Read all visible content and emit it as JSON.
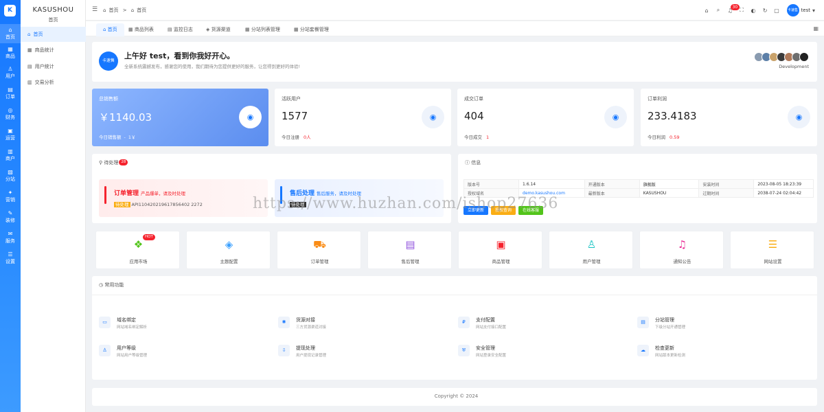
{
  "rail": {
    "logo": "K",
    "items": [
      "首页",
      "商品",
      "用户",
      "订单",
      "财务",
      "运营",
      "商户",
      "分站",
      "营销",
      "装修",
      "服务",
      "设置"
    ]
  },
  "side": {
    "brand": "KASUSHOU",
    "sub": "首页",
    "items": [
      "首页",
      "商品统计",
      "用户统计",
      "交易分析"
    ]
  },
  "header": {
    "crumb": [
      "首页",
      ">",
      "首页"
    ],
    "notif_count": "30",
    "avatar_text": "卡速售",
    "username": "test"
  },
  "tabs": [
    "首页",
    "商品列表",
    "监控日志",
    "货源渠道",
    "分站列表管理",
    "分站套餐管理"
  ],
  "welcome": {
    "logo_text": "卡速售",
    "title": "上午好 test，看到你我好开心。",
    "subtitle": "全新系统震撼发布，感谢您的使用，我们期待为您提供更好的服务，让您得到更好的体验!",
    "team_label": "Development"
  },
  "stats": [
    {
      "title": "总销售额",
      "value": "￥1140.03",
      "foot": "今日销售额",
      "foot_value": "1￥"
    },
    {
      "title": "活跃用户",
      "value": "1577",
      "foot": "今日注册",
      "foot_value": "0人"
    },
    {
      "title": "成交订单",
      "value": "404",
      "foot": "今日成交",
      "foot_value": "1"
    },
    {
      "title": "订单利润",
      "value": "233.4183",
      "foot": "今日利润",
      "foot_value": "0.59"
    }
  ],
  "pending": {
    "title": "待处理",
    "count": "28",
    "order": {
      "title": "订单管理",
      "desc": "产品爆单，请及时处理",
      "tag": "待处理",
      "order_no": "API110420219617856402 2272"
    },
    "after": {
      "title": "售后处理",
      "desc": "售后服务，请及时处理",
      "tag": "待处理"
    }
  },
  "info": {
    "title": "信息",
    "rows": [
      [
        "版本号",
        "1.6.14",
        "开通版本",
        "旗舰版",
        "安装时间",
        "2023-08-05 18:23:39"
      ],
      [
        "授权域名",
        "demo.kasushou.com",
        "最新版本",
        "KASUSHOU",
        "过期时间",
        "2038-07-24 02:04:42"
      ]
    ],
    "buttons": [
      "立即更新",
      "授权查询",
      "在线客服"
    ]
  },
  "quick": [
    {
      "label": "应用市场",
      "icon": "app-grid-icon",
      "hot": "HOT"
    },
    {
      "label": "主题配置",
      "icon": "theme-icon"
    },
    {
      "label": "订单管理",
      "icon": "cart-icon"
    },
    {
      "label": "售后管理",
      "icon": "document-icon"
    },
    {
      "label": "商品管理",
      "icon": "box-icon"
    },
    {
      "label": "用户管理",
      "icon": "user-icon"
    },
    {
      "label": "通知公告",
      "icon": "bell-icon"
    },
    {
      "label": "网站设置",
      "icon": "sliders-icon"
    }
  ],
  "functions": {
    "title": "常用功能",
    "items": [
      {
        "label": "域名绑定",
        "desc": "网站域名绑定解析"
      },
      {
        "label": "货源对接",
        "desc": "三方货源渠道对接"
      },
      {
        "label": "支付配置",
        "desc": "网站支付接口配置"
      },
      {
        "label": "分站管理",
        "desc": "下级分站开通管理"
      },
      {
        "label": "用户等级",
        "desc": "网站用户等级管理"
      },
      {
        "label": "提现处理",
        "desc": "用户提现记录管理"
      },
      {
        "label": "安全管理",
        "desc": "网站登录安全配置"
      },
      {
        "label": "检查更新",
        "desc": "网站版本更新检测"
      }
    ]
  },
  "footer": "Copyright © 2024",
  "watermark": "https://www.huzhan.com/ishop27636",
  "colors": {
    "accent": "#1677ff",
    "danger": "#f5222d",
    "warning": "#faad14",
    "success": "#52c41a"
  }
}
